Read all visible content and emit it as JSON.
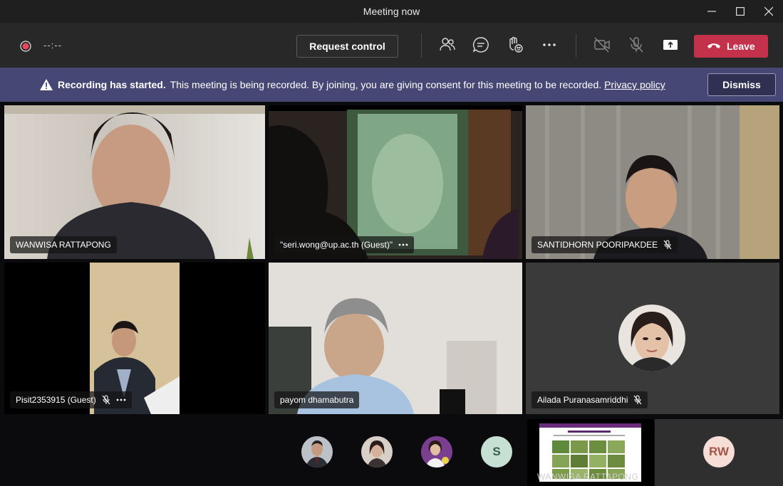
{
  "window": {
    "title": "Meeting now"
  },
  "toolbar": {
    "timer": "--:--",
    "request_control": "Request control",
    "leave": "Leave",
    "icons": [
      "record-icon",
      "participants-icon",
      "chat-icon",
      "reactions-icon",
      "more-icon",
      "camera-off-icon",
      "mic-off-icon",
      "share-icon",
      "phone-icon"
    ]
  },
  "banner": {
    "title": "Recording has started.",
    "message": "This meeting is being recorded. By joining, you are giving consent for this meeting to be recorded.",
    "link": "Privacy policy",
    "dismiss": "Dismiss"
  },
  "participants": [
    {
      "name": "WANWISA RATTAPONG"
    },
    {
      "name": "\"seri.wong@up.ac.th (Guest)\""
    },
    {
      "name": "SANTIDHORN POORIPAKDEE"
    },
    {
      "name": "Pisit2353915 (Guest)"
    },
    {
      "name": "payom dhamabutra"
    },
    {
      "name": "Ailada Puranasamriddhi"
    }
  ],
  "bottom": {
    "initial_s": "S",
    "initial_rw": "RW",
    "share_caption": "WANWISA RATTAPONG"
  },
  "colors": {
    "leave_red": "#c4314b",
    "banner": "#464775",
    "record": "#e8495f"
  }
}
